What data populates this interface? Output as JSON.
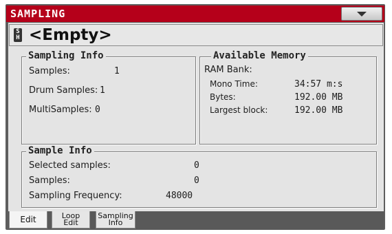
{
  "window": {
    "title": "SAMPLING",
    "menu_icon": "chevron-down-icon"
  },
  "sample": {
    "badge_top": "S",
    "badge_bottom": "H",
    "name": "<Empty>"
  },
  "sampling_info": {
    "title": "Sampling Info",
    "rows": [
      {
        "label": "Samples:",
        "value": "1"
      },
      {
        "label": "Drum Samples:",
        "value": "1"
      },
      {
        "label": "MultiSamples:",
        "value": "0"
      }
    ]
  },
  "memory": {
    "title": "Available Memory",
    "bank_label": "RAM Bank:",
    "rows": [
      {
        "label": "Mono Time:",
        "value": "34:57 m:s"
      },
      {
        "label": "Bytes:",
        "value": "192.00 MB"
      },
      {
        "label": "Largest block:",
        "value": "192.00 MB"
      }
    ]
  },
  "sample_info": {
    "title": "Sample Info",
    "rows": [
      {
        "label": "Selected samples:",
        "value": "0"
      },
      {
        "label": "Samples:",
        "value": "0"
      },
      {
        "label": "Sampling Frequency:",
        "value": "48000"
      }
    ]
  },
  "tabs": [
    {
      "label": "Edit"
    },
    {
      "label_line1": "Loop",
      "label_line2": "Edit"
    },
    {
      "label_line1": "Sampling",
      "label_line2": "Info",
      "active": true
    }
  ]
}
